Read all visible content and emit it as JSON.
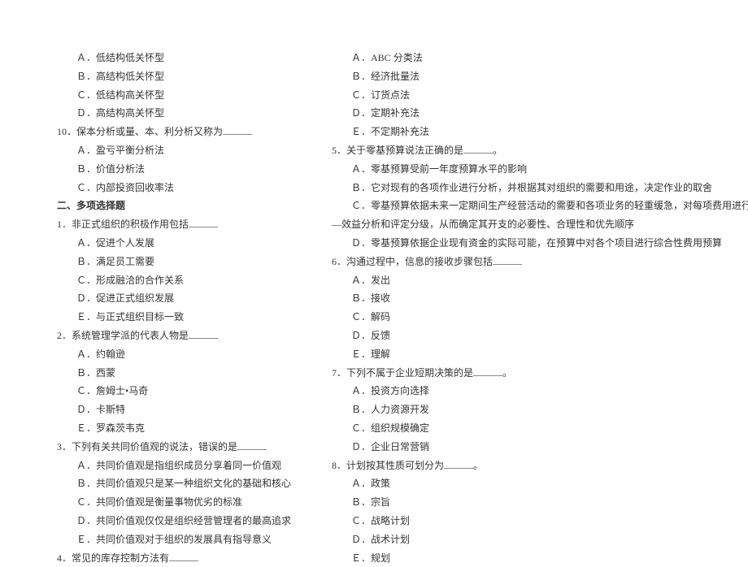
{
  "left": {
    "opts1": [
      "Ａ．低结构低关怀型",
      "Ｂ．高结构低关怀型",
      "Ｃ．低结构高关怀型",
      "Ｄ．高结构高关怀型"
    ],
    "q10": "10．保本分析或量、本、利分析又称为",
    "q10opts": [
      "Ａ．盈亏平衡分析法",
      "Ｂ．价值分析法",
      "Ｃ．内部投资回收率法"
    ],
    "section2": "二、多项选择题",
    "q1": "1．非正式组织的积极作用包括",
    "q1opts": [
      "Ａ．促进个人发展",
      "Ｂ．满足员工需要",
      "Ｃ．形成融洽的合作关系",
      "Ｄ．促进正式组织发展",
      "Ｅ．与正式组织目标一致"
    ],
    "q2": "2．系统管理学派的代表人物是",
    "q2opts": [
      "Ａ．约翰逊",
      "Ｂ．西蒙",
      "Ｃ．詹姆士•马奇",
      "Ｄ．卡斯特",
      "Ｅ．罗森茨韦克"
    ],
    "q3": "3．下列有关共同价值观的说法，错误的是",
    "q3opts": [
      "Ａ．共同价值观是指组织成员分享着同一价值观",
      "Ｂ．共同价值观只是某一种组织文化的基础和核心",
      "Ｃ．共同价值观是衡量事物优劣的标准",
      "Ｄ．共同价值观仅仅是组织经营管理者的最高追求",
      "Ｅ．共同价值观对于组织的发展具有指导意义"
    ],
    "q4": "4．常见的库存控制方法有"
  },
  "right": {
    "q4opts": [
      "Ａ．ABC 分类法",
      "Ｂ．经济批量法",
      "Ｃ．订货点法",
      "Ｄ．定期补充法",
      "Ｅ．不定期补充法"
    ],
    "q5": "5．关于零基预算说法正确的是",
    "q5tail": "。",
    "q5opts": [
      "Ａ．零基预算受前一年度预算水平的影响",
      "Ｂ．它对现有的各项作业进行分析，并根据其对组织的需要和用途，决定作业的取舍",
      "Ｃ．零基预算依据未来一定期间生产经营活动的需要和各项业务的轻重缓急，对每项费用进行成本"
    ],
    "q5cont": "—效益分析和评定分级，从而确定其开支的必要性、合理性和优先顺序",
    "q5opts2": [
      "Ｄ．零基预算依据企业现有资金的实际可能，在预算中对各个项目进行综合性费用预算"
    ],
    "q6": "6．沟通过程中，信息的接收步骤包括",
    "q6opts": [
      "Ａ．发出",
      "Ｂ．接收",
      "Ｃ．解码",
      "Ｄ．反馈",
      "Ｅ．理解"
    ],
    "q7": "7．下列不属于企业短期决策的是",
    "q7tail": "。",
    "q7opts": [
      "Ａ．投资方向选择",
      "Ｂ．人力资源开发",
      "Ｃ．组织规模确定",
      "Ｄ．企业日常营销"
    ],
    "q8": "8．计划按其性质可划分为",
    "q8tail": "。",
    "q8opts": [
      "Ａ．政策",
      "Ｂ．宗旨",
      "Ｃ．战略计划",
      "Ｄ．战术计划",
      "Ｅ．规划"
    ]
  }
}
